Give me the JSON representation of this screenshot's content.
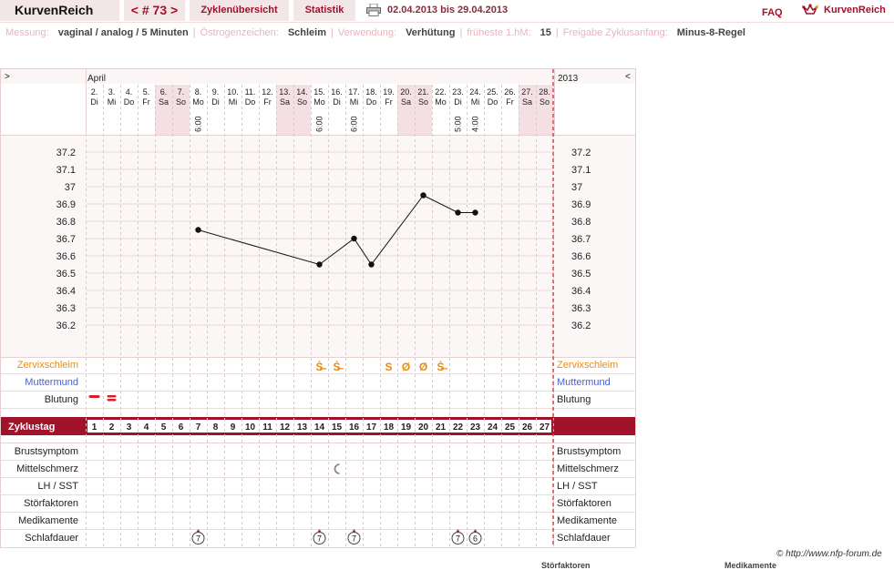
{
  "header": {
    "logo": "KurvenReich",
    "cycle_nav": "< # 73 >",
    "tab_cycle_overview": "Zyklenübersicht",
    "tab_statistics": "Statistik",
    "date_range": "02.04.2013 bis 29.04.2013",
    "faq": "FAQ",
    "brand": "KurvenReich"
  },
  "info": [
    {
      "key": "Messung:",
      "value": "vaginal / analog / 5 Minuten"
    },
    {
      "key": "Östrogenzeichen:",
      "value": "Schleim"
    },
    {
      "key": "Verwendung:",
      "value": "Verhütung"
    },
    {
      "key": "früheste 1.hM:",
      "value": "15"
    },
    {
      "key": "Freigabe Zyklusanfang:",
      "value": "Minus-8-Regel"
    }
  ],
  "chart_data": {
    "type": "line",
    "month": "April",
    "year": "2013",
    "nav_prev": ">",
    "nav_next": "<",
    "dates": [
      "2.",
      "3.",
      "4.",
      "5.",
      "6.",
      "7.",
      "8.",
      "9.",
      "10.",
      "11.",
      "12.",
      "13.",
      "14.",
      "15.",
      "16.",
      "17.",
      "18.",
      "19.",
      "20.",
      "21.",
      "22.",
      "23.",
      "24.",
      "25.",
      "26.",
      "27.",
      "28."
    ],
    "weekdays": [
      "Di",
      "Mi",
      "Do",
      "Fr",
      "Sa",
      "So",
      "Mo",
      "Di",
      "Mi",
      "Do",
      "Fr",
      "Sa",
      "So",
      "Mo",
      "Di",
      "Mi",
      "Do",
      "Fr",
      "Sa",
      "So",
      "Mo",
      "Di",
      "Mi",
      "Do",
      "Fr",
      "Sa",
      "So"
    ],
    "weekend": [
      false,
      false,
      false,
      false,
      true,
      true,
      false,
      false,
      false,
      false,
      false,
      true,
      true,
      false,
      false,
      false,
      false,
      false,
      true,
      true,
      false,
      false,
      false,
      false,
      false,
      true,
      true
    ],
    "times": [
      {
        "day": 7,
        "time": "6:00"
      },
      {
        "day": 14,
        "time": "6:00"
      },
      {
        "day": 16,
        "time": "6:00"
      },
      {
        "day": 22,
        "time": "5:00"
      },
      {
        "day": 23,
        "time": "4:00"
      }
    ],
    "ylim": [
      36.1,
      37.3
    ],
    "yticks": [
      "37.2",
      "37.1",
      "37",
      "36.9",
      "36.8",
      "36.7",
      "36.6",
      "36.5",
      "36.4",
      "36.3",
      "36.2"
    ],
    "temperature": [
      {
        "day": 7,
        "value": 36.75
      },
      {
        "day": 14,
        "value": 36.55
      },
      {
        "day": 16,
        "value": 36.7
      },
      {
        "day": 17,
        "value": 36.55
      },
      {
        "day": 20,
        "value": 36.95
      },
      {
        "day": 22,
        "value": 36.85
      },
      {
        "day": 23,
        "value": 36.85
      }
    ],
    "rows": {
      "cervical_mucus": "Zervixschleim",
      "cervix": "Muttermund",
      "bleeding": "Blutung",
      "cycle_day": "Zyklustag",
      "breast": "Brustsymptom",
      "mittelschmerz": "Mittelschmerz",
      "lh": "LH / SST",
      "disturbances": "Störfaktoren",
      "medication": "Medikamente",
      "sleep": "Schlafdauer"
    },
    "mucus": [
      {
        "day": 14,
        "symbol": "Ṡ̶"
      },
      {
        "day": 15,
        "symbol": "Ṡ̶"
      },
      {
        "day": 18,
        "symbol": "S"
      },
      {
        "day": 19,
        "symbol": "Ø"
      },
      {
        "day": 20,
        "symbol": "Ø"
      },
      {
        "day": 21,
        "symbol": "Ṡ̶"
      }
    ],
    "bleeding": [
      {
        "day": 1,
        "level": "light"
      },
      {
        "day": 2,
        "level": "medium"
      }
    ],
    "cycle_days": [
      "1",
      "2",
      "3",
      "4",
      "5",
      "6",
      "7",
      "8",
      "9",
      "10",
      "11",
      "12",
      "13",
      "14",
      "15",
      "16",
      "17",
      "18",
      "19",
      "20",
      "21",
      "22",
      "23",
      "24",
      "25",
      "26",
      "27"
    ],
    "mittelschmerz_days": [
      15
    ],
    "sleep": [
      {
        "day": 7,
        "hours": "7"
      },
      {
        "day": 14,
        "hours": "7"
      },
      {
        "day": 16,
        "hours": "7"
      },
      {
        "day": 22,
        "hours": "7"
      },
      {
        "day": 23,
        "hours": "6"
      }
    ]
  },
  "footer": {
    "copyright": "© http://www.nfp-forum.de",
    "col1": "Störfaktoren",
    "col2": "Medikamente"
  },
  "colors": {
    "accent": "#a0112a",
    "weekend": "#f4dfe3",
    "mucus": "#e98c14",
    "cervix": "#4a5fc7"
  }
}
